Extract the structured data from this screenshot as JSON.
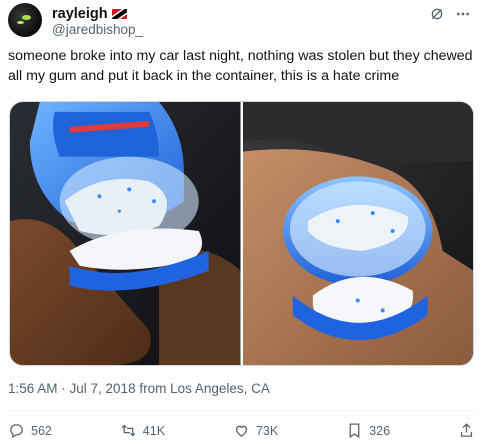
{
  "user": {
    "display_name": "rayleigh",
    "handle": "@jaredbishop_",
    "flag": "trinidad-tobago-flag"
  },
  "tweet": {
    "text": "someone broke into my car last night, nothing was stolen but they chewed all my gum and put it back in the container, this is a hate crime",
    "timestamp": "1:56 AM · Jul 7, 2018 from Los Angeles, CA"
  },
  "media": {
    "count": 2,
    "photo1_caption": "gum container with chewed gum (left hand)",
    "photo2_caption": "gum container with chewed gum (right hand)"
  },
  "stats": {
    "replies": "562",
    "retweets": "41K",
    "likes": "73K",
    "bookmarks": "326"
  },
  "icons": {
    "grok": "grok-icon",
    "more": "more-icon",
    "reply": "reply-icon",
    "retweet": "retweet-icon",
    "like": "like-icon",
    "bookmark": "bookmark-icon",
    "share": "share-icon"
  },
  "colors": {
    "text": "#0f1419",
    "secondary": "#536471",
    "border": "#cfd9de"
  }
}
